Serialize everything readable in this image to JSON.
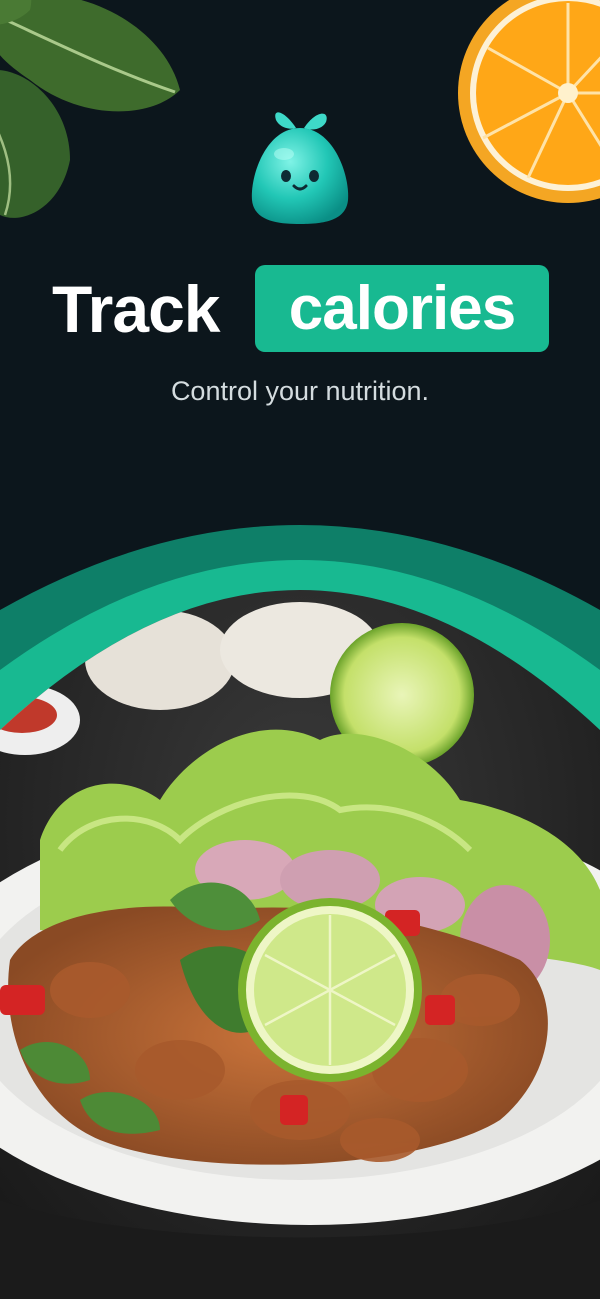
{
  "headline": {
    "word1": "Track",
    "word2": "calories"
  },
  "subtitle": "Control your nutrition.",
  "colors": {
    "background": "#0c161c",
    "accent": "#18b991",
    "accent_dark": "#0e7f68",
    "text": "#ffffff",
    "subtext": "#d4dcdf"
  },
  "icons": {
    "mascot": "green-sprout-mascot",
    "top_left": "spinach-leaf",
    "top_right": "orange-slice"
  }
}
